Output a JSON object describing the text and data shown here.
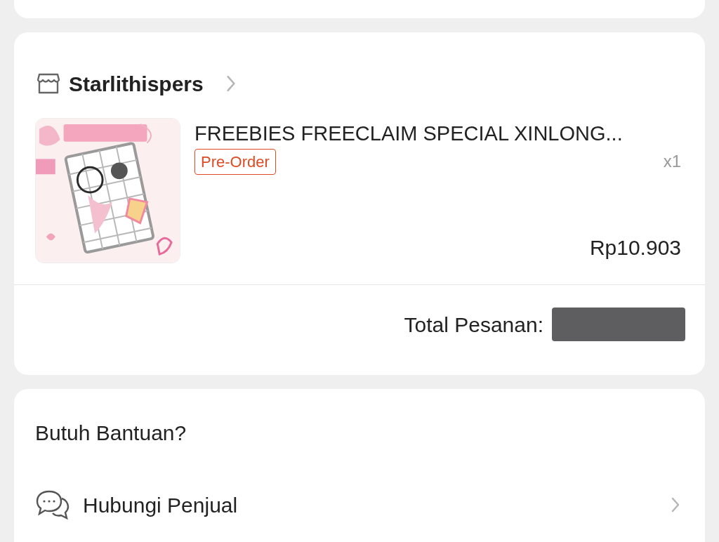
{
  "order": {
    "shop": {
      "name": "Starlithispers"
    },
    "items": [
      {
        "title": "FREEBIES FREECLAIM SPECIAL XINLONG...",
        "badge": "Pre-Order",
        "quantity": "x1",
        "price": "Rp10.903"
      }
    ],
    "total": {
      "label": "Total Pesanan:",
      "redacted": true
    }
  },
  "help": {
    "title": "Butuh Bantuan?",
    "items": [
      {
        "label": "Hubungi Penjual"
      }
    ]
  }
}
